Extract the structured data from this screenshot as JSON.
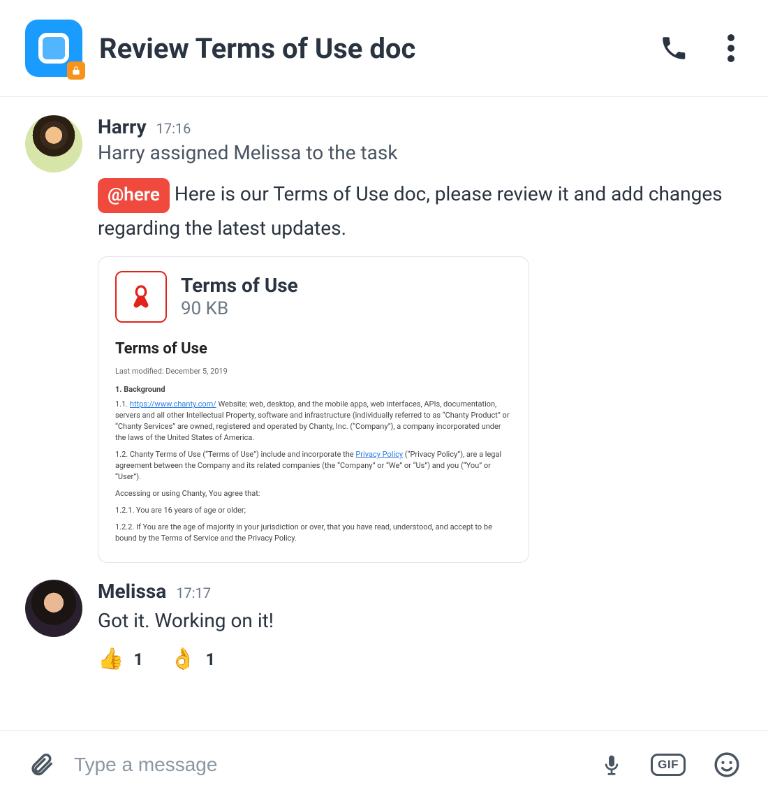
{
  "header": {
    "title": "Review Terms of Use doc"
  },
  "messages": [
    {
      "author": "Harry",
      "time": "17:16",
      "system": "Harry assigned Melissa to the task",
      "mention": "@here",
      "text": " Here is our Terms of Use doc, please review it and add changes regarding the latest updates.",
      "attachment": {
        "name": "Terms of Use",
        "size": "90 KB",
        "preview": {
          "title": "Terms of Use",
          "meta": "Last modified: December 5, 2019",
          "heading1": "1. Background",
          "p1a": "1.1. ",
          "p1link": "https://www.chanty.com/",
          "p1b": " Website; web, desktop, and the mobile apps, web interfaces, APIs, documentation, servers and all other Intellectual Property, software and infrastructure (individually referred to as “Chanty Product” or “Chanty Services” are owned, registered and operated by Chanty, Inc. (“Company”), a company incorporated under the laws of the United States of America.",
          "p2a": "1.2. Chanty Terms of Use (“Terms of Use”) include and incorporate the ",
          "p2link": "Privacy Policy",
          "p2b": " (“Privacy Policy”), are a legal agreement between the Company and its related companies (the “Company” or “We” or “Us”) and you (“You” or “User”).",
          "p3": "Accessing or using Chanty, You agree that:",
          "p4": "1.2.1. You are 16 years of age or older;",
          "p5": "1.2.2. If You are the age of majority in your jurisdiction or over, that you have read, understood, and accept to be bound by the Terms of Service and the Privacy Policy."
        }
      }
    },
    {
      "author": "Melissa",
      "time": "17:17",
      "text": "Got it. Working on it!",
      "reactions": [
        {
          "emoji": "👍",
          "count": "1"
        },
        {
          "emoji": "👌",
          "count": "1"
        }
      ]
    }
  ],
  "composer": {
    "placeholder": "Type a message",
    "gif_label": "GIF"
  }
}
